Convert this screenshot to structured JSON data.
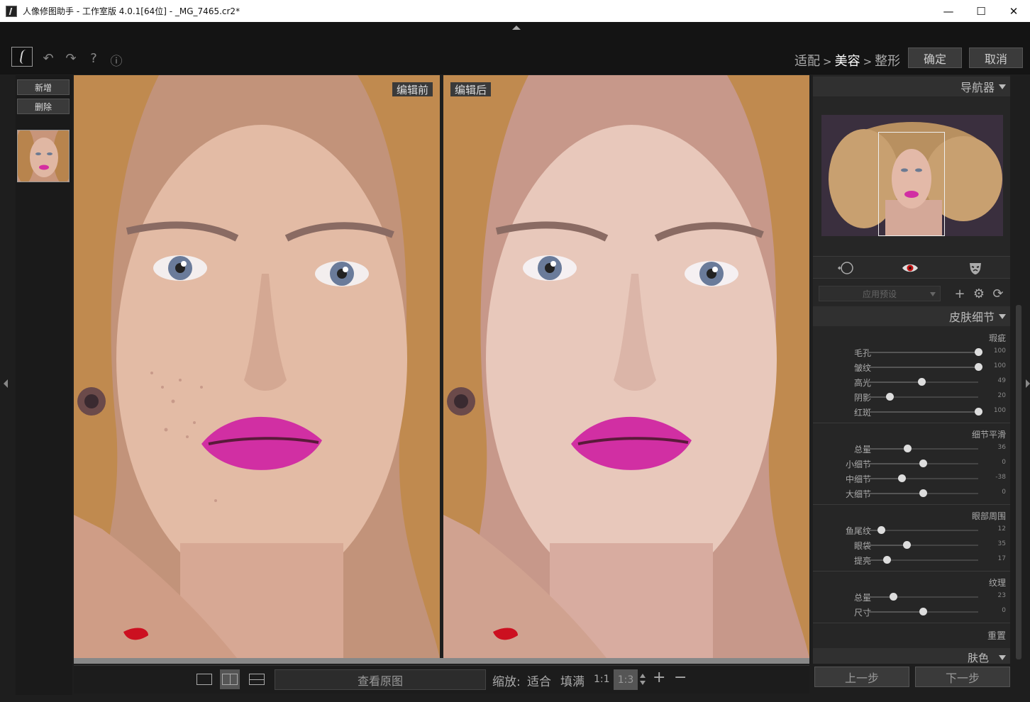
{
  "window": {
    "title": "人像修图助手 - 工作室版 4.0.1[64位] - _MG_7465.cr2*",
    "minimize": "—",
    "maximize": "☐",
    "close": "✕"
  },
  "toolbar": {
    "undo": "↶",
    "redo": "↷",
    "help": "?",
    "info": "ⓘ"
  },
  "steps": [
    "适配",
    "美容",
    "整形"
  ],
  "steps_sep": ">",
  "confirm_label": "确定",
  "cancel_label": "取消",
  "left": {
    "add_label": "新增",
    "delete_label": "删除"
  },
  "photos": {
    "before_label": "编辑前",
    "after_label": "编辑后"
  },
  "bottom": {
    "compare_label": "查看原图",
    "zoom_label": "缩放:",
    "fit_label": "适合",
    "fill_label": "填满",
    "one_label": "1:1",
    "ratio_value": "1:3",
    "zoom_in": "+",
    "zoom_out": "−"
  },
  "navigator": {
    "title": "导航器"
  },
  "preset": {
    "placeholder": "应用预设",
    "add": "+",
    "settings": "⚙",
    "refresh": "⟳"
  },
  "skin": {
    "title": "皮肤细节",
    "groups": [
      {
        "title": "瑕疵",
        "sliders": [
          {
            "label": "毛孔",
            "value": 100,
            "fraction": 1.0
          },
          {
            "label": "皱纹",
            "value": 100,
            "fraction": 1.0
          },
          {
            "label": "高光",
            "value": 49,
            "fraction": 0.49
          },
          {
            "label": "阴影",
            "value": 20,
            "fraction": 0.2
          },
          {
            "label": "红斑",
            "value": 100,
            "fraction": 1.0
          }
        ]
      },
      {
        "title": "细节平滑",
        "sliders": [
          {
            "label": "总量",
            "value": 36,
            "fraction": 0.36
          },
          {
            "label": "小细节",
            "value": 0,
            "fraction": 0.5
          },
          {
            "label": "中细节",
            "value": -38,
            "fraction": 0.31
          },
          {
            "label": "大细节",
            "value": 0,
            "fraction": 0.5
          }
        ]
      },
      {
        "title": "眼部周围",
        "sliders": [
          {
            "label": "鱼尾纹",
            "value": 12,
            "fraction": 0.12
          },
          {
            "label": "眼袋",
            "value": 35,
            "fraction": 0.35
          },
          {
            "label": "提亮",
            "value": 17,
            "fraction": 0.17
          }
        ]
      },
      {
        "title": "纹理",
        "sliders": [
          {
            "label": "总量",
            "value": 23,
            "fraction": 0.23
          },
          {
            "label": "尺寸",
            "value": 0,
            "fraction": 0.5
          }
        ]
      }
    ],
    "reset_label": "重置"
  },
  "next_section": "肤色",
  "prev_step_label": "上一步",
  "next_step_label": "下一步",
  "icons": [
    "app-logo-icon",
    "undo-icon",
    "redo-icon",
    "help-icon",
    "info-icon",
    "face-profile-icon",
    "red-eye-icon",
    "mask-icon"
  ],
  "colors": {
    "accent": "#555555",
    "panel": "#262626",
    "background": "#1e1e1e"
  }
}
